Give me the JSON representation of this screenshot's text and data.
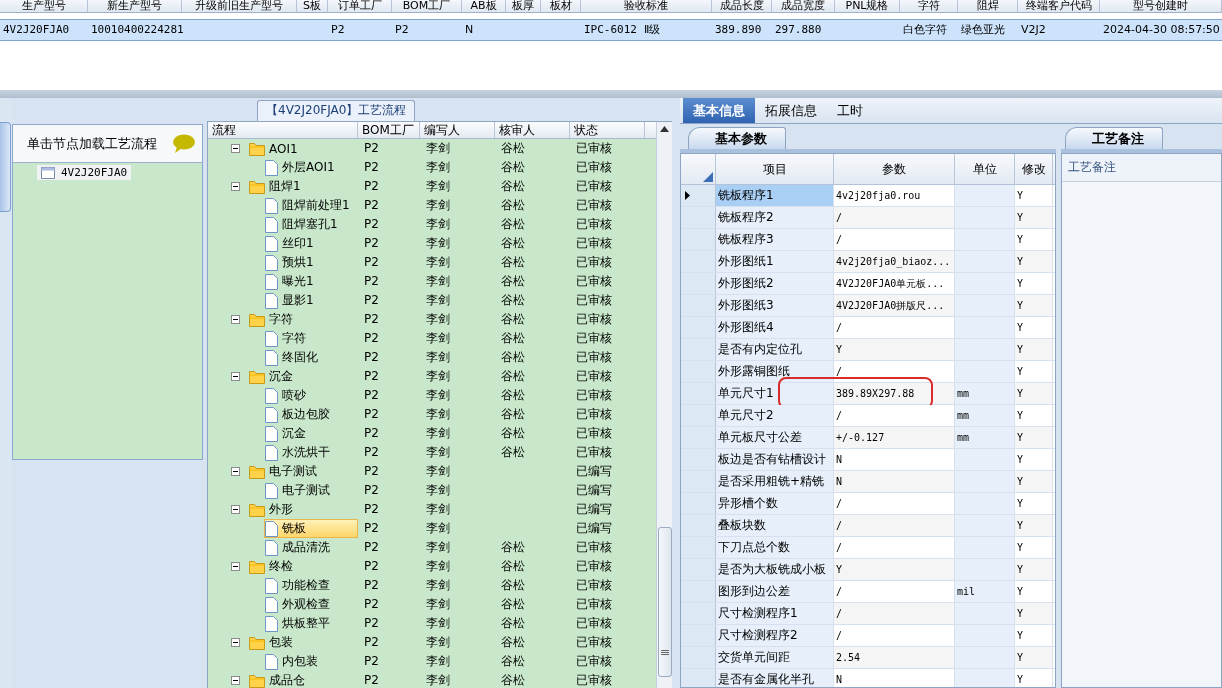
{
  "top_table": {
    "columns": [
      "生产型号",
      "新生产型号",
      "升级前旧生产型号",
      "S板",
      "订单工厂",
      "BOM工厂",
      "AB板",
      "板厚",
      "板材",
      "验收标准",
      "成品长度",
      "成品宽度",
      "PNL规格",
      "字符",
      "阻焊",
      "终端客户代码",
      "型号创建时"
    ],
    "rows": [
      {
        "selected": true,
        "cells": [
          "4V2J20FJA0",
          "10010400224281",
          null,
          null,
          "P2",
          "P2",
          "N",
          null,
          null,
          "IPC-6012 Ⅱ级",
          "389.890",
          "297.880",
          null,
          "白色字符",
          "绿色亚光",
          "V2J2",
          "2024-04-30 08:57:50"
        ]
      }
    ]
  },
  "left_panel": {
    "title": "单击节点加载工艺流程",
    "nodes": [
      {
        "label": "4V2J20FJA0",
        "selected": false
      }
    ]
  },
  "process_panel": {
    "title": "【4V2J20FJA0】工艺流程",
    "columns": [
      "流程",
      "BOM工厂",
      "编写人",
      "核审人",
      "状态"
    ],
    "tree": [
      {
        "name": "AOI1",
        "bom": "P2",
        "writer": "李剑",
        "reviewer": "谷松",
        "status": "已审核",
        "expanded": true,
        "selected": false,
        "children": [
          {
            "name": "外层AOI1",
            "bom": "P2",
            "writer": "李剑",
            "reviewer": "谷松",
            "status": "已审核",
            "selected": false
          }
        ]
      },
      {
        "name": "阻焊1",
        "bom": "P2",
        "writer": "李剑",
        "reviewer": "谷松",
        "status": "已审核",
        "expanded": true,
        "selected": false,
        "children": [
          {
            "name": "阻焊前处理1",
            "bom": "P2",
            "writer": "李剑",
            "reviewer": "谷松",
            "status": "已审核",
            "selected": false
          },
          {
            "name": "阻焊塞孔1",
            "bom": "P2",
            "writer": "李剑",
            "reviewer": "谷松",
            "status": "已审核",
            "selected": false
          },
          {
            "name": "丝印1",
            "bom": "P2",
            "writer": "李剑",
            "reviewer": "谷松",
            "status": "已审核",
            "selected": false
          },
          {
            "name": "预烘1",
            "bom": "P2",
            "writer": "李剑",
            "reviewer": "谷松",
            "status": "已审核",
            "selected": false
          },
          {
            "name": "曝光1",
            "bom": "P2",
            "writer": "李剑",
            "reviewer": "谷松",
            "status": "已审核",
            "selected": false
          },
          {
            "name": "显影1",
            "bom": "P2",
            "writer": "李剑",
            "reviewer": "谷松",
            "status": "已审核",
            "selected": false
          }
        ]
      },
      {
        "name": "字符",
        "bom": "P2",
        "writer": "李剑",
        "reviewer": "谷松",
        "status": "已审核",
        "expanded": true,
        "selected": false,
        "children": [
          {
            "name": "字符",
            "bom": "P2",
            "writer": "李剑",
            "reviewer": "谷松",
            "status": "已审核",
            "selected": false
          },
          {
            "name": "终固化",
            "bom": "P2",
            "writer": "李剑",
            "reviewer": "谷松",
            "status": "已审核",
            "selected": false
          }
        ]
      },
      {
        "name": "沉金",
        "bom": "P2",
        "writer": "李剑",
        "reviewer": "谷松",
        "status": "已审核",
        "expanded": true,
        "selected": false,
        "children": [
          {
            "name": "喷砂",
            "bom": "P2",
            "writer": "李剑",
            "reviewer": "谷松",
            "status": "已审核",
            "selected": false
          },
          {
            "name": "板边包胶",
            "bom": "P2",
            "writer": "李剑",
            "reviewer": "谷松",
            "status": "已审核",
            "selected": false
          },
          {
            "name": "沉金",
            "bom": "P2",
            "writer": "李剑",
            "reviewer": "谷松",
            "status": "已审核",
            "selected": false
          },
          {
            "name": "水洗烘干",
            "bom": "P2",
            "writer": "李剑",
            "reviewer": "谷松",
            "status": "已审核",
            "selected": false
          }
        ]
      },
      {
        "name": "电子测试",
        "bom": "P2",
        "writer": "李剑",
        "status": "已编写",
        "expanded": true,
        "selected": false,
        "children": [
          {
            "name": "电子测试",
            "bom": "P2",
            "writer": "李剑",
            "status": "已编写",
            "selected": false
          }
        ]
      },
      {
        "name": "外形",
        "bom": "P2",
        "writer": "李剑",
        "status": "已编写",
        "expanded": true,
        "selected": false,
        "children": [
          {
            "name": "铣板",
            "bom": "P2",
            "writer": "李剑",
            "status": "已编写",
            "selected": true
          },
          {
            "name": "成品清洗",
            "bom": "P2",
            "writer": "李剑",
            "reviewer": "谷松",
            "status": "已审核",
            "selected": false
          }
        ]
      },
      {
        "name": "终检",
        "bom": "P2",
        "writer": "李剑",
        "reviewer": "谷松",
        "status": "已审核",
        "expanded": true,
        "selected": false,
        "children": [
          {
            "name": "功能检查",
            "bom": "P2",
            "writer": "李剑",
            "reviewer": "谷松",
            "status": "已审核",
            "selected": false
          },
          {
            "name": "外观检查",
            "bom": "P2",
            "writer": "李剑",
            "reviewer": "谷松",
            "status": "已审核",
            "selected": false
          },
          {
            "name": "烘板整平",
            "bom": "P2",
            "writer": "李剑",
            "reviewer": "谷松",
            "status": "已审核",
            "selected": false
          }
        ]
      },
      {
        "name": "包装",
        "bom": "P2",
        "writer": "李剑",
        "reviewer": "谷松",
        "status": "已审核",
        "expanded": true,
        "selected": false,
        "children": [
          {
            "name": "内包装",
            "bom": "P2",
            "writer": "李剑",
            "reviewer": "谷松",
            "status": "已审核",
            "selected": false
          }
        ]
      },
      {
        "name": "成品仓",
        "bom": "P2",
        "writer": "李剑",
        "reviewer": "谷松",
        "status": "已审核",
        "expanded": true,
        "selected": false
      }
    ]
  },
  "detail_panel": {
    "tabs": [
      {
        "label": "基本信息",
        "selected": true
      },
      {
        "label": "拓展信息",
        "selected": false
      },
      {
        "label": "工时",
        "selected": false
      }
    ],
    "params_tab": "基本参数",
    "columns": [
      "项目",
      "参数",
      "单位",
      "修改"
    ],
    "rows": [
      {
        "item": "铣板程序1",
        "value": "4v2j20fja0.rou",
        "modified": "Y",
        "selected": true,
        "circled": false
      },
      {
        "item": "铣板程序2",
        "value": "/",
        "modified": "Y",
        "selected": false,
        "circled": false
      },
      {
        "item": "铣板程序3",
        "value": "/",
        "modified": "Y",
        "selected": false,
        "circled": false
      },
      {
        "item": "外形图纸1",
        "value": "4v2j20fja0_biaoz...",
        "modified": "Y",
        "selected": false,
        "circled": false
      },
      {
        "item": "外形图纸2",
        "value": "4V2J20FJA0单元板...",
        "modified": "Y",
        "selected": false,
        "circled": false
      },
      {
        "item": "外形图纸3",
        "value": "4V2J20FJA0拼版尺...",
        "modified": "Y",
        "selected": false,
        "circled": false
      },
      {
        "item": "外形图纸4",
        "value": "/",
        "modified": "Y",
        "selected": false,
        "circled": false
      },
      {
        "item": "是否有内定位孔",
        "value": "Y",
        "modified": "Y",
        "selected": false,
        "circled": false
      },
      {
        "item": "外形露铜图纸",
        "value": "/",
        "modified": "Y",
        "selected": false,
        "circled": false
      },
      {
        "item": "单元尺寸1",
        "value": "389.89X297.88",
        "unit": "mm",
        "modified": "Y",
        "selected": false,
        "circled": true
      },
      {
        "item": "单元尺寸2",
        "value": "/",
        "unit": "mm",
        "modified": "Y",
        "selected": false,
        "circled": false
      },
      {
        "item": "单元板尺寸公差",
        "value": "+/-0.127",
        "unit": "mm",
        "modified": "Y",
        "selected": false,
        "circled": false
      },
      {
        "item": "板边是否有钻槽设计",
        "value": "N",
        "modified": "Y",
        "selected": false,
        "circled": false
      },
      {
        "item": "是否采用粗铣+精铣",
        "value": "N",
        "modified": "Y",
        "selected": false,
        "circled": false
      },
      {
        "item": "异形槽个数",
        "value": "/",
        "modified": "Y",
        "selected": false,
        "circled": false
      },
      {
        "item": "叠板块数",
        "value": "/",
        "modified": "Y",
        "selected": false,
        "circled": false
      },
      {
        "item": "下刀点总个数",
        "value": "/",
        "modified": "Y",
        "selected": false,
        "circled": false
      },
      {
        "item": "是否为大板铣成小板",
        "value": "Y",
        "modified": "Y",
        "selected": false,
        "circled": false
      },
      {
        "item": "图形到边公差",
        "value": "/",
        "unit": "mil",
        "modified": "Y",
        "selected": false,
        "circled": false
      },
      {
        "item": "尺寸检测程序1",
        "value": "/",
        "modified": "Y",
        "selected": false,
        "circled": false
      },
      {
        "item": "尺寸检测程序2",
        "value": "/",
        "modified": "Y",
        "selected": false,
        "circled": false
      },
      {
        "item": "交货单元间距",
        "value": "2.54",
        "modified": "Y",
        "selected": false,
        "circled": false
      },
      {
        "item": "是否有金属化半孔",
        "value": "N",
        "modified": "Y",
        "selected": false,
        "circled": false
      }
    ],
    "notes_tab": "工艺备注",
    "notes_label": "工艺备注"
  }
}
